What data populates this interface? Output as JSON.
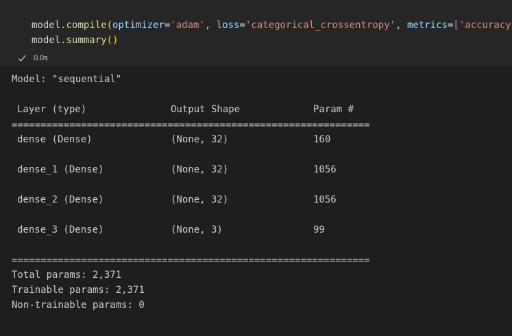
{
  "cell": {
    "line1": {
      "obj": "model",
      "dot": ".",
      "fn": "compile",
      "open": "(",
      "arg1": "optimizer",
      "eq1": "=",
      "val1": "'adam'",
      "sep1": ", ",
      "arg2": "loss",
      "eq2": "=",
      "val2": "'categorical_crossentropy'",
      "sep2": ", ",
      "arg3": "metrics",
      "eq3": "=",
      "lb": "[",
      "val3": "'accuracy'",
      "rb": "]",
      "close": ")"
    },
    "line2": {
      "obj": "model",
      "dot": ".",
      "fn": "summary",
      "call": "()"
    },
    "exec_time": "0.0s"
  },
  "output": {
    "model_line": "Model: \"sequential\"",
    "dash_rule": "_________________________________________________________________",
    "eq_rule": "=================================================================",
    "headers": {
      "layer": "Layer (type)",
      "shape": "Output Shape",
      "params": "Param #"
    },
    "rows": [
      {
        "layer": "dense (Dense)",
        "shape": "(None, 32)",
        "params": "160"
      },
      {
        "layer": "dense_1 (Dense)",
        "shape": "(None, 32)",
        "params": "1056"
      },
      {
        "layer": "dense_2 (Dense)",
        "shape": "(None, 32)",
        "params": "1056"
      },
      {
        "layer": "dense_3 (Dense)",
        "shape": "(None, 3)",
        "params": "99"
      }
    ],
    "total": "Total params: 2,371",
    "trainable": "Trainable params: 2,371",
    "non_trainable": "Non-trainable params: 0"
  },
  "colors": {
    "background": "#1e1e1e",
    "cell_background": "#262626",
    "success": "#89d185"
  },
  "icons": {
    "status": "check-icon"
  }
}
